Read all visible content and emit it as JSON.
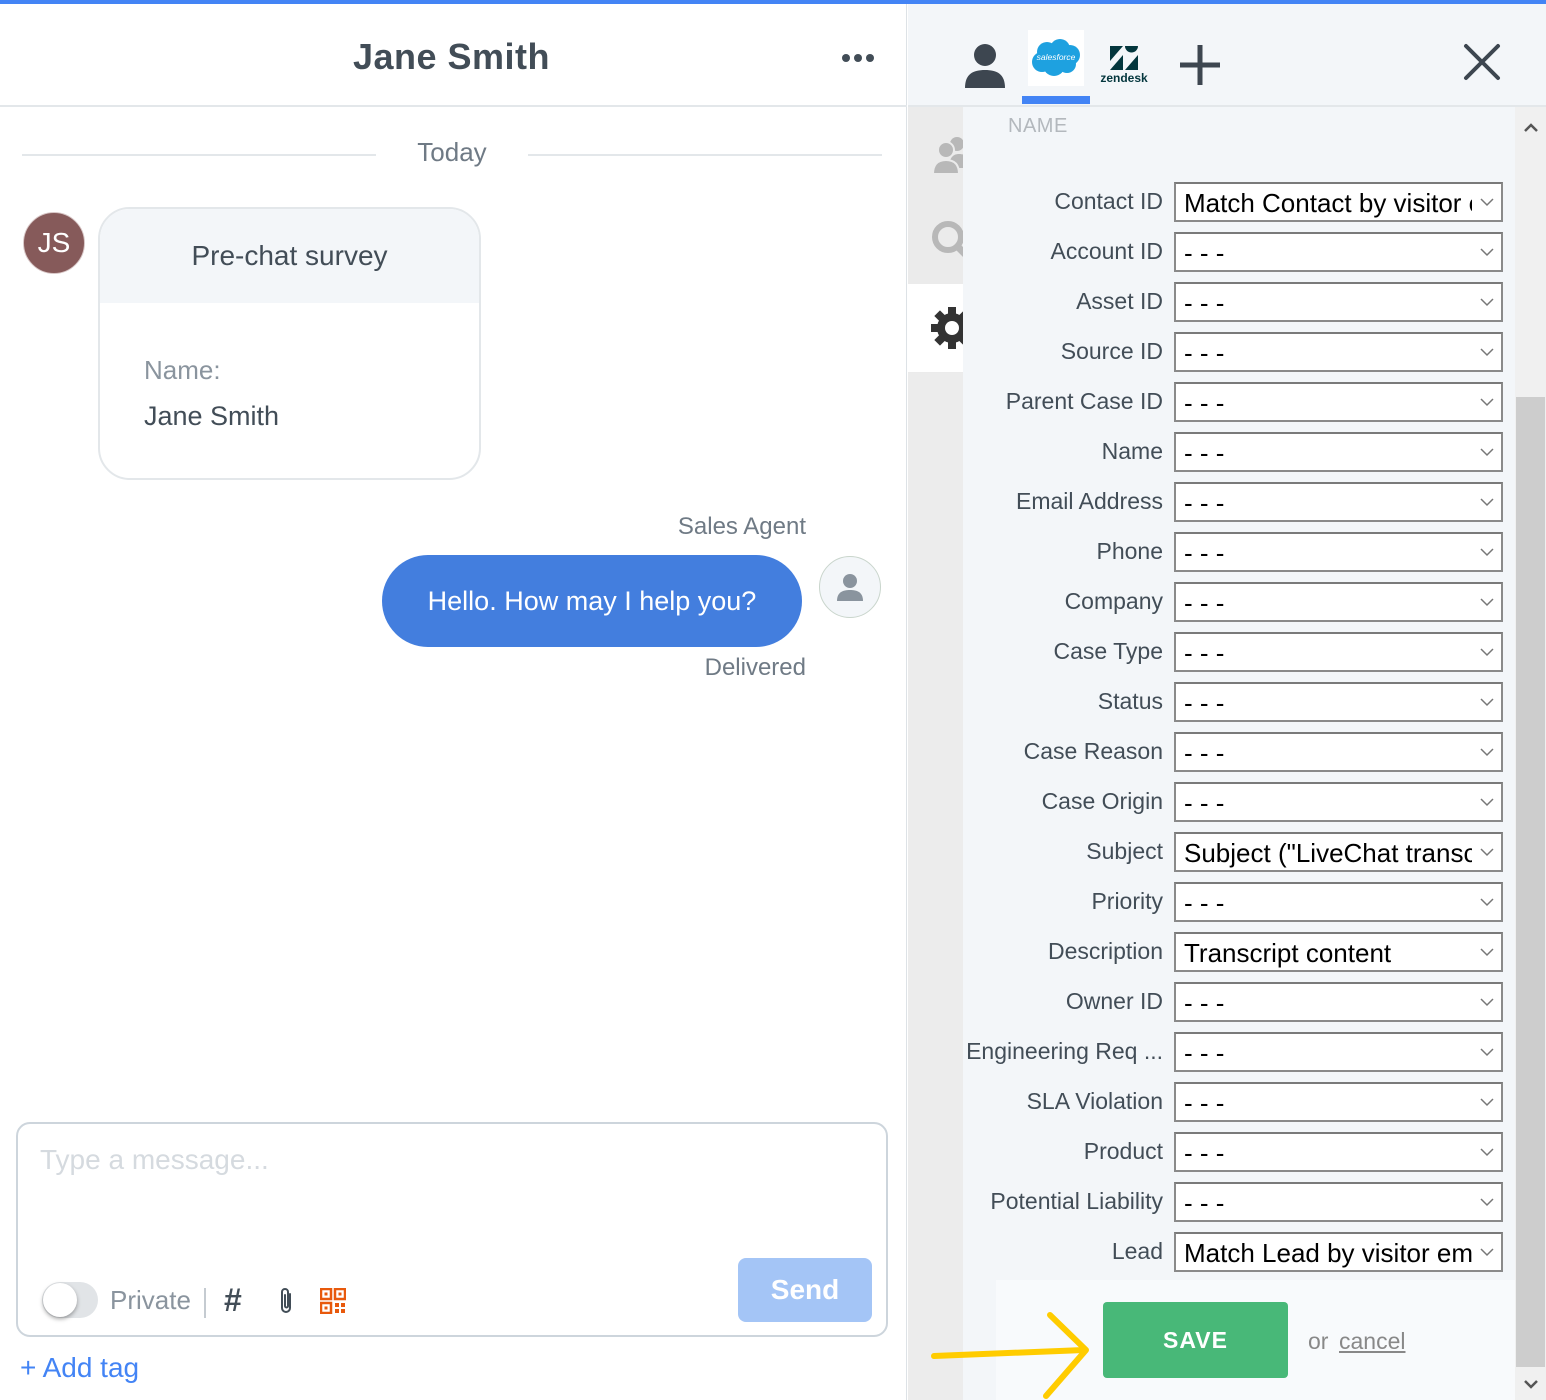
{
  "colors": {
    "accent": "#4384f5",
    "bubble": "#437ede",
    "save": "#48b878",
    "send_disabled": "#a4c5f6",
    "avatar_js": "#865a5a",
    "qr_icon": "#e8590c",
    "annotation_arrow": "#ffcc00"
  },
  "chat": {
    "header": {
      "title": "Jane Smith",
      "more_icon": "more-horizontal-icon"
    },
    "day_separator": "Today",
    "messages": [
      {
        "type": "survey",
        "author_initials": "JS",
        "title": "Pre-chat survey",
        "fields": [
          {
            "label": "Name:",
            "value": "Jane Smith"
          }
        ]
      },
      {
        "type": "text",
        "author": "Sales Agent",
        "text": "Hello. How may I help you?",
        "status": "Delivered"
      }
    ],
    "composer": {
      "placeholder": "Type a message...",
      "value": "",
      "private_label": "Private",
      "private_enabled": false,
      "tools": [
        "hashtag-icon",
        "paperclip-icon",
        "qr-code-icon"
      ],
      "send_label": "Send"
    },
    "add_tag_label": "+ Add tag"
  },
  "side": {
    "tabs": [
      {
        "name": "customer",
        "icon": "person-icon",
        "active": false
      },
      {
        "name": "salesforce",
        "label": "salesforce",
        "active": true
      },
      {
        "name": "zendesk",
        "label": "zendesk",
        "active": false
      },
      {
        "name": "add",
        "icon": "plus-icon",
        "active": false
      }
    ],
    "close_icon": "close-icon",
    "nav": [
      {
        "name": "contacts",
        "icon": "contacts-icon",
        "active": false
      },
      {
        "name": "search",
        "icon": "search-icon",
        "active": false
      },
      {
        "name": "settings",
        "icon": "gear-icon",
        "active": true
      }
    ],
    "form": {
      "section_heading": "NAME",
      "fields": [
        {
          "label": "Contact ID",
          "value": "Match Contact by visitor email"
        },
        {
          "label": "Account ID",
          "value": "- - -"
        },
        {
          "label": "Asset ID",
          "value": "- - -"
        },
        {
          "label": "Source ID",
          "value": "- - -"
        },
        {
          "label": "Parent Case ID",
          "value": "- - -"
        },
        {
          "label": "Name",
          "value": "- - -"
        },
        {
          "label": "Email Address",
          "value": "- - -"
        },
        {
          "label": "Phone",
          "value": "- - -"
        },
        {
          "label": "Company",
          "value": "- - -"
        },
        {
          "label": "Case Type",
          "value": "- - -"
        },
        {
          "label": "Status",
          "value": "- - -"
        },
        {
          "label": "Case Reason",
          "value": "- - -"
        },
        {
          "label": "Case Origin",
          "value": "- - -"
        },
        {
          "label": "Subject",
          "value": "Subject (\"LiveChat transcript\")"
        },
        {
          "label": "Priority",
          "value": "- - -"
        },
        {
          "label": "Description",
          "value": "Transcript content"
        },
        {
          "label": "Owner ID",
          "value": "- - -"
        },
        {
          "label": "Engineering Req ...",
          "value": "- - -"
        },
        {
          "label": "SLA Violation",
          "value": "- - -"
        },
        {
          "label": "Product",
          "value": "- - -"
        },
        {
          "label": "Potential Liability",
          "value": "- - -"
        },
        {
          "label": "Lead",
          "value": "Match Lead by visitor email"
        }
      ],
      "save_label": "SAVE",
      "or_label": "or",
      "cancel_label": "cancel"
    }
  }
}
